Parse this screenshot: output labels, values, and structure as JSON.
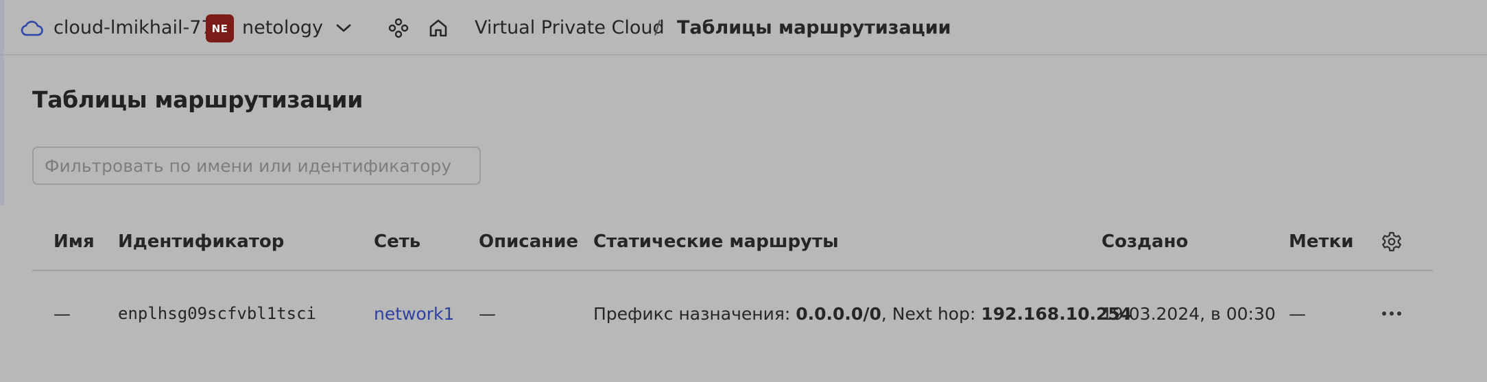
{
  "header": {
    "cloud_name": "cloud-lmikhail-77",
    "org_badge": "NE",
    "org_name": "netology",
    "breadcrumb": {
      "service": "Virtual Private Cloud",
      "separator": "/",
      "current": "Таблицы маршрутизации"
    },
    "icons": [
      "cloud-icon",
      "chevron-down-icon",
      "nodes-icon",
      "home-icon"
    ]
  },
  "page": {
    "title": "Таблицы маршрутизации",
    "filter_placeholder": "Фильтровать по имени или идентификатору",
    "filter_value": ""
  },
  "table": {
    "columns": [
      "Имя",
      "Идентификатор",
      "Сеть",
      "Описание",
      "Статические маршруты",
      "Создано",
      "Метки"
    ],
    "rows": [
      {
        "name": "—",
        "id": "enplhsg09scfvbl1tsci",
        "network": "network1",
        "description": "—",
        "routes": {
          "prefix_label": "Префикс назначения:",
          "prefix_value": "0.0.0.0/0",
          "hop_label": ", Next hop:",
          "hop_value": "192.168.10.254"
        },
        "created": "19.03.2024, в 00:30",
        "labels": "—"
      }
    ]
  },
  "colors": {
    "background": "#b8b8b8",
    "org_badge": "#7c1c18",
    "link": "#2e3fa0",
    "cloud_icon": "#2f47a8"
  }
}
